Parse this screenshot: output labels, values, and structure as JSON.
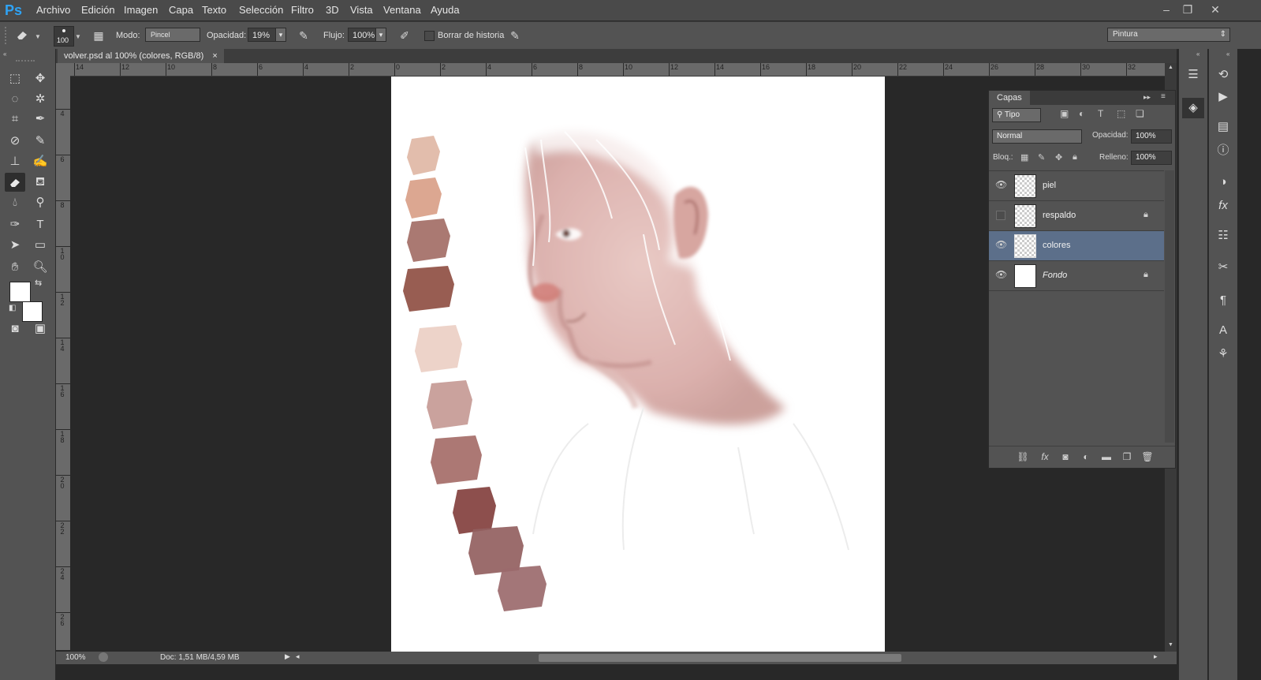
{
  "app": {
    "logo": "Ps"
  },
  "menu": [
    "Archivo",
    "Edición",
    "Imagen",
    "Capa",
    "Texto",
    "Selección",
    "Filtro",
    "3D",
    "Vista",
    "Ventana",
    "Ayuda"
  ],
  "window_controls": {
    "minimize": "–",
    "restore": "❐",
    "close": "✕"
  },
  "options": {
    "tool_icon": "eraser-icon",
    "brush_size": "100",
    "mode_label": "Modo:",
    "mode_value": "Pincel",
    "opacity_label": "Opacidad:",
    "opacity_value": "19%",
    "flow_label": "Flujo:",
    "flow_value": "100%",
    "erase_history_label": "Borrar de historia",
    "workspace": "Pintura"
  },
  "document": {
    "tab_title": "volver.psd al 100% (colores, RGB/8)",
    "tab_close": "×",
    "zoom": "100%",
    "doc_info": "Doc: 1,51 MB/4,59 MB"
  },
  "rulers": {
    "h": [
      "14",
      "12",
      "10",
      "8",
      "6",
      "4",
      "2",
      "0",
      "2",
      "4",
      "6",
      "8",
      "10",
      "12",
      "14",
      "16",
      "18",
      "20",
      "22",
      "24",
      "26",
      "28",
      "30",
      "32"
    ],
    "v": [
      "4",
      "6",
      "8",
      "10",
      "12",
      "14",
      "16",
      "18",
      "20",
      "22",
      "24",
      "26"
    ]
  },
  "layers_panel": {
    "tab": "Capas",
    "filter_label": "Tipo",
    "blend_mode": "Normal",
    "opacity_label": "Opacidad:",
    "opacity_value": "100%",
    "lock_label": "Bloq.:",
    "fill_label": "Relleno:",
    "fill_value": "100%",
    "layers": [
      {
        "name": "piel",
        "visible": true,
        "locked": false
      },
      {
        "name": "respaldo",
        "visible": false,
        "locked": true
      },
      {
        "name": "colores",
        "visible": true,
        "locked": false,
        "selected": true
      },
      {
        "name": "Fondo",
        "visible": true,
        "locked": true
      }
    ]
  },
  "swatch_colors": [
    "#dfb7a5",
    "#d9a088",
    "#a36e66",
    "#8f4f43",
    "#eccfc4",
    "#c69a95",
    "#a56d68",
    "#83403e",
    "#93605f",
    "#9b6a6d"
  ]
}
